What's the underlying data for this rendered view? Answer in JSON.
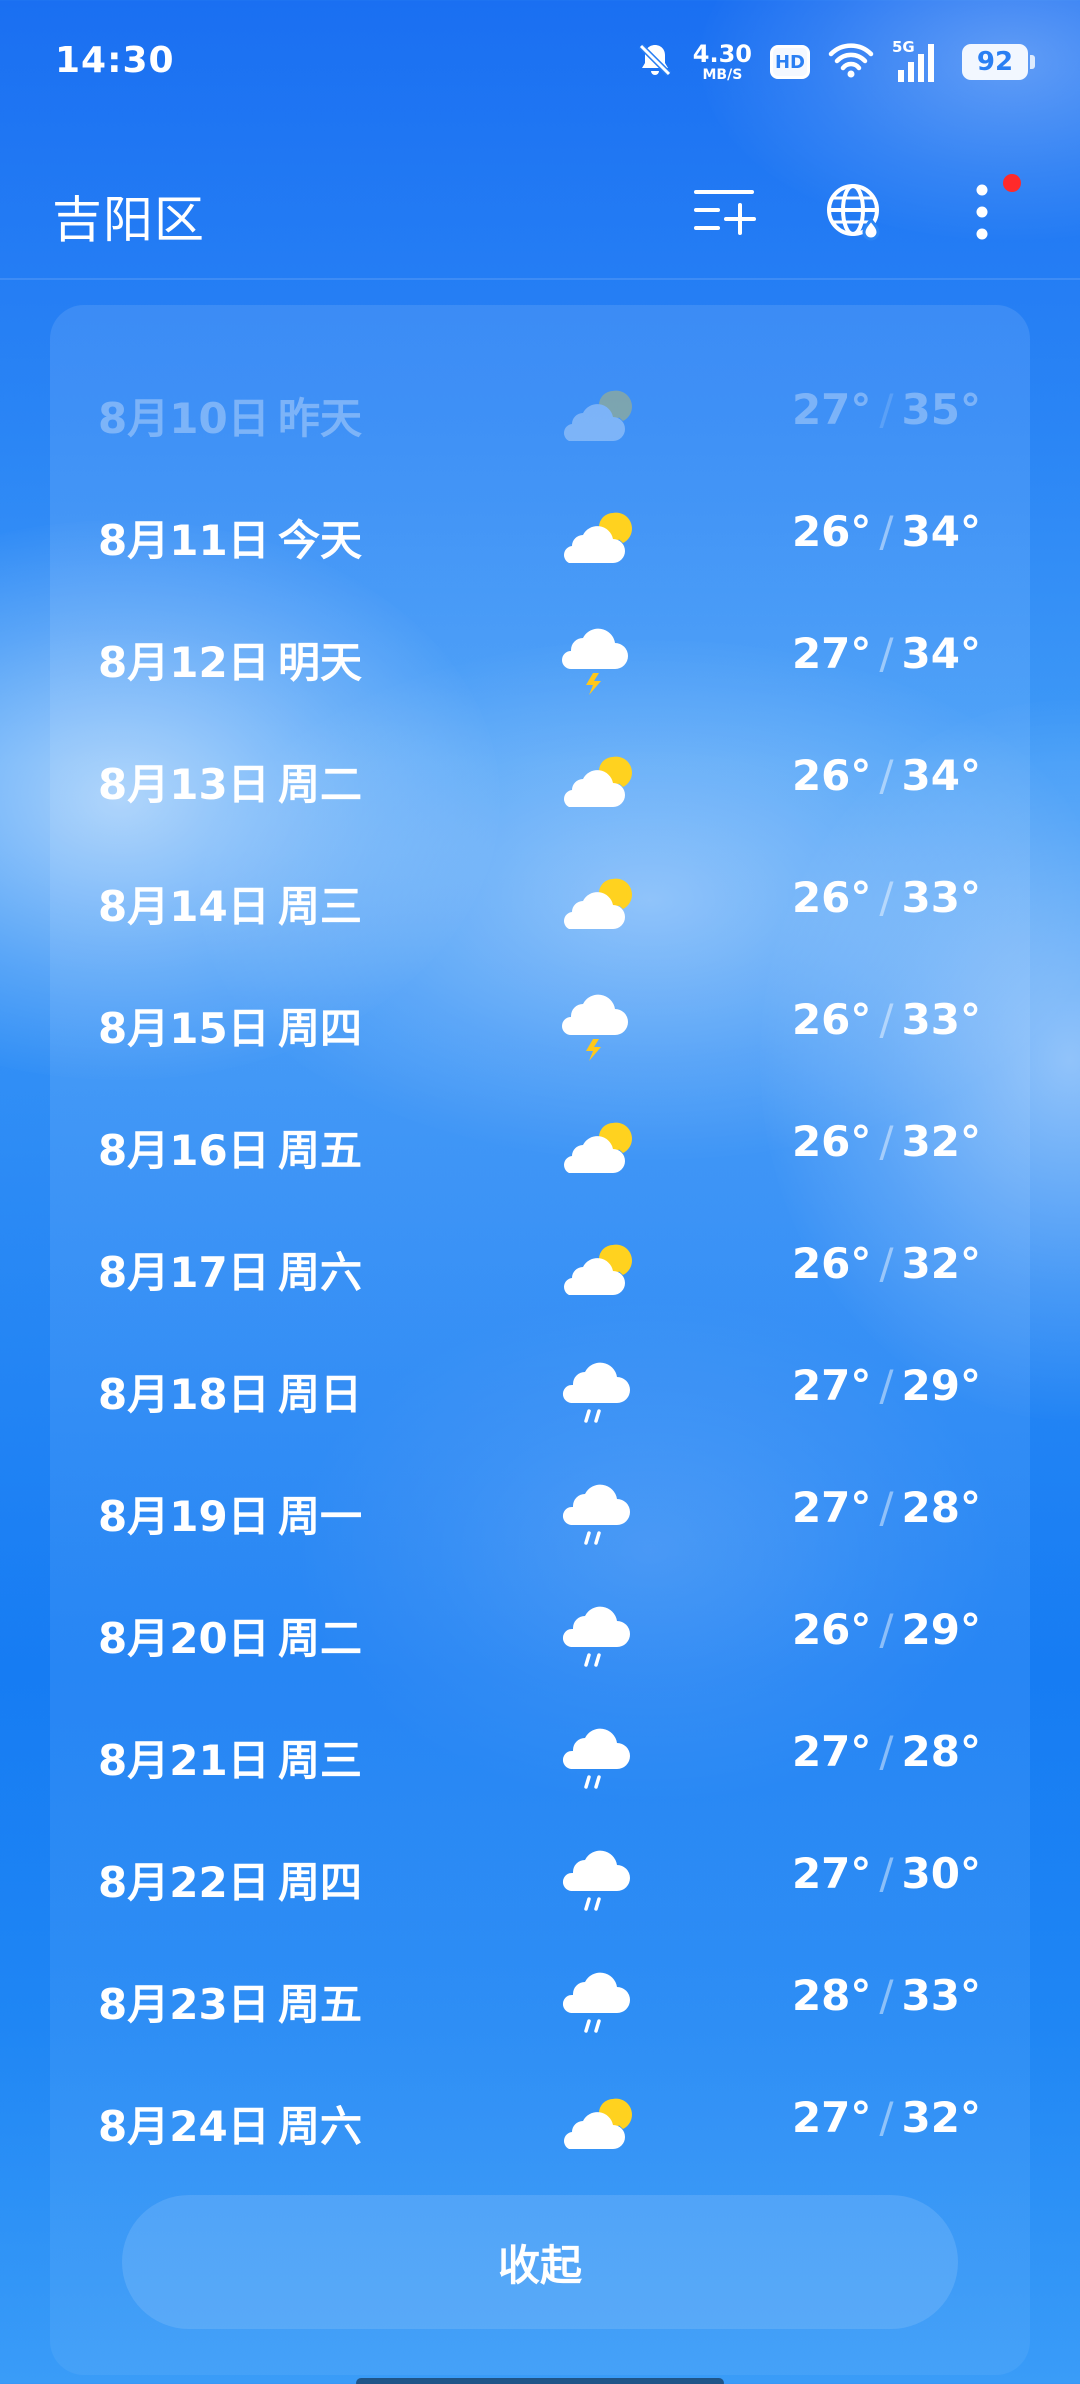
{
  "status_bar": {
    "time": "14:30",
    "net_speed_value": "4.30",
    "net_speed_unit": "MB/S",
    "hd_label": "HD",
    "signal_label": "5G",
    "battery": "92"
  },
  "header": {
    "title": "吉阳区",
    "icons": [
      "add-city-icon",
      "globe-icon",
      "more-icon"
    ]
  },
  "forecast": [
    {
      "date": "8月10日",
      "weekday": "昨天",
      "icon": "partly-cloudy",
      "low": "27°",
      "high": "35°",
      "past": true
    },
    {
      "date": "8月11日",
      "weekday": "今天",
      "icon": "partly-cloudy",
      "low": "26°",
      "high": "34°"
    },
    {
      "date": "8月12日",
      "weekday": "明天",
      "icon": "thunderstorm",
      "low": "27°",
      "high": "34°"
    },
    {
      "date": "8月13日",
      "weekday": "周二",
      "icon": "partly-cloudy",
      "low": "26°",
      "high": "34°"
    },
    {
      "date": "8月14日",
      "weekday": "周三",
      "icon": "partly-cloudy",
      "low": "26°",
      "high": "33°"
    },
    {
      "date": "8月15日",
      "weekday": "周四",
      "icon": "thunderstorm",
      "low": "26°",
      "high": "33°"
    },
    {
      "date": "8月16日",
      "weekday": "周五",
      "icon": "partly-cloudy",
      "low": "26°",
      "high": "32°"
    },
    {
      "date": "8月17日",
      "weekday": "周六",
      "icon": "partly-cloudy",
      "low": "26°",
      "high": "32°"
    },
    {
      "date": "8月18日",
      "weekday": "周日",
      "icon": "rain",
      "low": "27°",
      "high": "29°"
    },
    {
      "date": "8月19日",
      "weekday": "周一",
      "icon": "rain",
      "low": "27°",
      "high": "28°"
    },
    {
      "date": "8月20日",
      "weekday": "周二",
      "icon": "rain",
      "low": "26°",
      "high": "29°"
    },
    {
      "date": "8月21日",
      "weekday": "周三",
      "icon": "rain",
      "low": "27°",
      "high": "28°"
    },
    {
      "date": "8月22日",
      "weekday": "周四",
      "icon": "rain",
      "low": "27°",
      "high": "30°"
    },
    {
      "date": "8月23日",
      "weekday": "周五",
      "icon": "rain",
      "low": "28°",
      "high": "33°"
    },
    {
      "date": "8月24日",
      "weekday": "周六",
      "icon": "partly-cloudy",
      "low": "27°",
      "high": "32°"
    }
  ],
  "temp_separator": "/",
  "collapse_label": "收起",
  "colors": {
    "background_top": "#1a6ff2",
    "background_bottom": "#3a9cf8",
    "sun": "#ffd21f",
    "lightning": "#ffc81a",
    "notification_dot": "#ff2a2a"
  }
}
